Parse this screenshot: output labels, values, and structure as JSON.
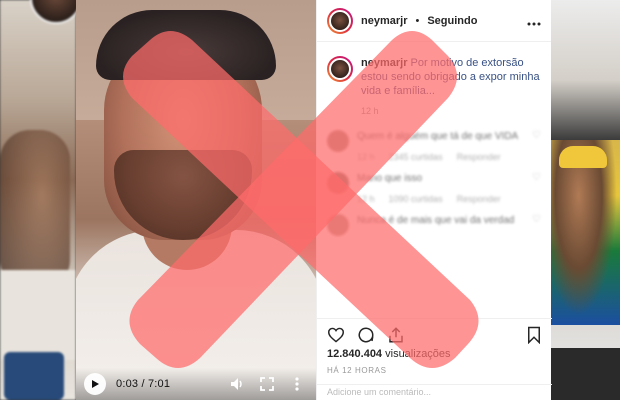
{
  "post": {
    "username": "neymarjr",
    "dot": "•",
    "follow_label": "Seguindo",
    "caption_user": "neymarjr",
    "caption_text": "Por motivo de extorsão estou sendo obrigado a expor minha vida e família...",
    "caption_time": "12 h",
    "views_count": "12.840.404",
    "views_label": "visualizações",
    "posted_ago": "HÁ 12 HORAS",
    "add_comment_placeholder": "Adicione um comentário..."
  },
  "comments": [
    {
      "text": "Quem é  alguém  que tá de que VIDA",
      "meta_time": "12 h",
      "meta_likes": "2345 curtidas",
      "meta_reply": "Responder"
    },
    {
      "text": "Mano que isso",
      "meta_time": "12 h",
      "meta_likes": "1090 curtidas",
      "meta_reply": "Responder"
    },
    {
      "text": "Nunca é de mais que vai da verdad",
      "meta_time": "",
      "meta_likes": "",
      "meta_reply": ""
    }
  ],
  "video": {
    "time_display": "0:03 / 7:01"
  },
  "icons": {
    "more": "more-options-icon",
    "like": "heart-icon",
    "comment": "comment-icon",
    "share": "share-icon",
    "save": "bookmark-icon",
    "play": "play-icon",
    "volume": "volume-icon",
    "fullscreen": "fullscreen-icon",
    "video_more": "vertical-more-icon"
  },
  "colors": {
    "overlay_x": "#ff6b6b",
    "link_blue": "#385185",
    "text": "#262626",
    "muted": "#999999"
  }
}
